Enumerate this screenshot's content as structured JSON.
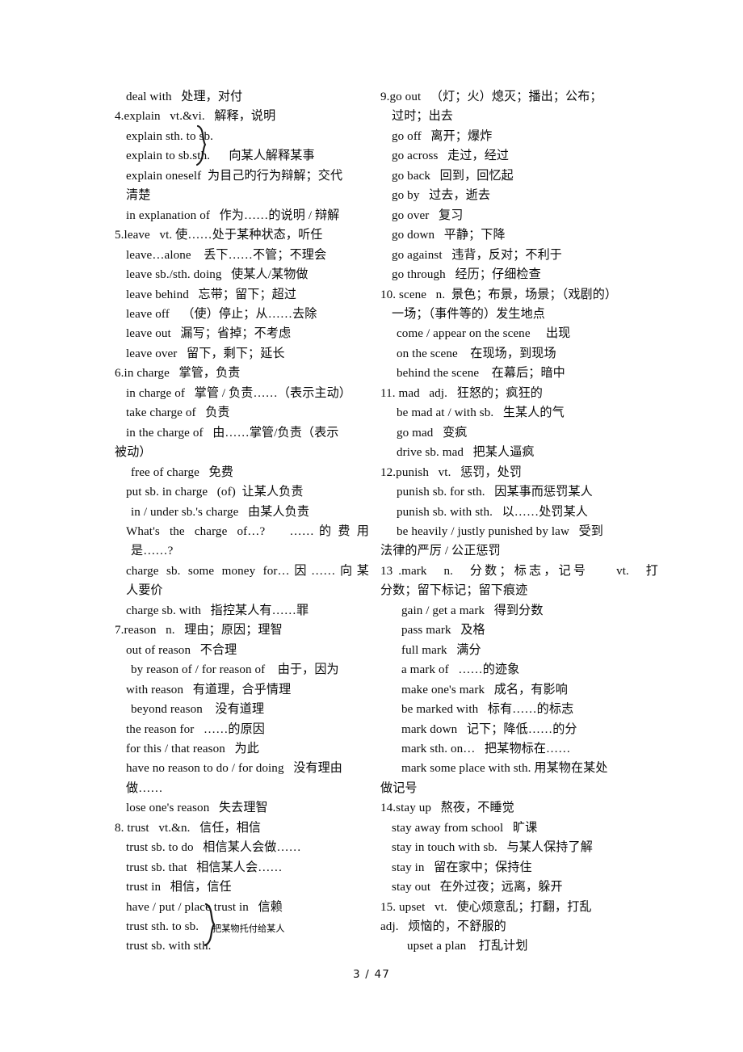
{
  "document": {
    "page_label": "3 / 47",
    "page_number": "3",
    "total_pages": "47"
  },
  "left_column": {
    "lines": [
      {
        "text": "deal with   处理，对付",
        "indent": "i1"
      },
      {
        "text": "4.explain   vt.&vi.   解释，说明",
        "indent": "i0"
      },
      {
        "text": "explain sth. to sb.",
        "indent": "i1"
      },
      {
        "text": "explain to sb.sth.      向某人解释某事",
        "indent": "i1"
      },
      {
        "text": "explain oneself  为目己旳行为辩解；交代",
        "indent": "i1"
      },
      {
        "text": "清楚",
        "indent": "i1"
      },
      {
        "text": "in explanation of   作为……的说明 / 辩解",
        "indent": "i1"
      },
      {
        "text": "5.leave   vt. 使……处于某种状态，听任",
        "indent": "i0"
      },
      {
        "text": "leave…alone    丢下……不管；不理会",
        "indent": "i1"
      },
      {
        "text": "leave sb./sth. doing   使某人/某物做",
        "indent": "i1"
      },
      {
        "text": "leave behind   忘带；留下；超过",
        "indent": "i1"
      },
      {
        "text": "leave off    （使）停止；从……去除",
        "indent": "i1"
      },
      {
        "text": "leave out   漏写；省掉；不考虑",
        "indent": "i1"
      },
      {
        "text": "leave over   留下，剩下；延长",
        "indent": "i1"
      },
      {
        "text": "6.in charge   掌管，负责",
        "indent": "i0"
      },
      {
        "text": "in charge of   掌管 / 负责……（表示主动）",
        "indent": "i1"
      },
      {
        "text": "take charge of   负责",
        "indent": "i1"
      },
      {
        "text": "in the charge of   由……掌管/负责（表示",
        "indent": "i1"
      },
      {
        "text": "被动）",
        "indent": "hang"
      },
      {
        "text": "free of charge   免费",
        "indent": "i2"
      },
      {
        "text": "put sb. in charge   (of)  让某人负责",
        "indent": "i1"
      },
      {
        "text": "in / under sb.'s charge   由某人负责",
        "indent": "i2"
      },
      {
        "text": "What's  the  charge  of…?     …… 的 费 用",
        "indent": "i1",
        "justify": "just"
      },
      {
        "text": "是……?",
        "indent": "i2"
      },
      {
        "text": "charge sb. some money for…因……向某",
        "indent": "i1",
        "justify": "just"
      },
      {
        "text": "人要价",
        "indent": "i1"
      },
      {
        "text": "charge sb. with   指控某人有……罪",
        "indent": "i1"
      },
      {
        "text": "7.reason   n.   理由；原因；理智",
        "indent": "i0"
      },
      {
        "text": "out of reason   不合理",
        "indent": "i1"
      },
      {
        "text": "by reason of / for reason of    由于，因为",
        "indent": "i2"
      },
      {
        "text": "with reason   有道理，合乎情理",
        "indent": "i1"
      },
      {
        "text": "beyond reason    没有道理",
        "indent": "i2"
      },
      {
        "text": "the reason for   ……的原因",
        "indent": "i1"
      },
      {
        "text": "for this / that reason   为此",
        "indent": "i1"
      },
      {
        "text": "have no reason to do / for doing   没有理由",
        "indent": "i1"
      },
      {
        "text": "做……",
        "indent": "i1"
      },
      {
        "text": "lose one's reason   失去理智",
        "indent": "i1"
      },
      {
        "text": "8. trust   vt.&n.   信任，相信",
        "indent": "i0"
      },
      {
        "text": "trust sb. to do   相信某人会做……",
        "indent": "i1"
      },
      {
        "text": "trust sb. that   相信某人会……",
        "indent": "i1"
      },
      {
        "text": "trust in   相信，信任",
        "indent": "i1"
      },
      {
        "text": "have / put / place trust in   信赖",
        "indent": "i1"
      },
      {
        "text": "trust sth. to sb.",
        "indent": "i1"
      },
      {
        "text": "trust sb. with sth.",
        "indent": "i1"
      }
    ],
    "annotation_note": "把某物托付给某人"
  },
  "right_column": {
    "lines": [
      {
        "text": "9.go out   （灯；火）熄灭；播出；公布；",
        "indent": "i0"
      },
      {
        "text": "过时；出去",
        "indent": "i1"
      },
      {
        "text": "go off   离开；爆炸",
        "indent": "i1"
      },
      {
        "text": "go across   走过，经过",
        "indent": "i1"
      },
      {
        "text": "go back   回到，回忆起",
        "indent": "i1"
      },
      {
        "text": "go by   过去，逝去",
        "indent": "i1"
      },
      {
        "text": "go over   复习",
        "indent": "i1"
      },
      {
        "text": "go down   平静；下降",
        "indent": "i1"
      },
      {
        "text": "go against   违背，反对；不利于",
        "indent": "i1"
      },
      {
        "text": "go through   经历；仔细检查",
        "indent": "i1"
      },
      {
        "text": "10. scene   n.  景色；布景，场景；（戏剧的）",
        "indent": "i0"
      },
      {
        "text": "一场；（事件等的）发生地点",
        "indent": "i1"
      },
      {
        "text": "come / appear on the scene     出现",
        "indent": "i2"
      },
      {
        "text": "on the scene    在现场，到现场",
        "indent": "i2"
      },
      {
        "text": "behind the scene    在幕后；暗中",
        "indent": "i2"
      },
      {
        "text": "11. mad   adj.   狂怒的；疯狂的",
        "indent": "i0"
      },
      {
        "text": "be mad at / with sb.   生某人的气",
        "indent": "i2"
      },
      {
        "text": "go mad   变疯",
        "indent": "i2"
      },
      {
        "text": "drive sb. mad   把某人逼疯",
        "indent": "i2"
      },
      {
        "text": "12.punish   vt.   惩罚，处罚",
        "indent": "i0"
      },
      {
        "text": "punish sb. for sth.   因某事而惩罚某人",
        "indent": "i2"
      },
      {
        "text": "punish sb. with sth.   以……处罚某人",
        "indent": "i2"
      },
      {
        "text": "be heavily / justly punished by law   受到",
        "indent": "i2"
      },
      {
        "text": "法律的严厉 / 公正惩罚",
        "indent": "hang"
      },
      {
        "text": "13 .mark   n.   分数；标志，记号     vt.   打",
        "indent": "i0",
        "justify": "just"
      },
      {
        "text": "分数；留下标记；留下痕迹",
        "indent": "hang"
      },
      {
        "text": "gain / get a mark   得到分数",
        "indent": "i3"
      },
      {
        "text": "pass mark   及格",
        "indent": "i3"
      },
      {
        "text": "full mark   满分",
        "indent": "i3"
      },
      {
        "text": "a mark of   ……的迹象",
        "indent": "i3"
      },
      {
        "text": "make one's mark   成名，有影响",
        "indent": "i3"
      },
      {
        "text": "be marked with   标有……的标志",
        "indent": "i3"
      },
      {
        "text": "mark down   记下；降低……的分",
        "indent": "i3"
      },
      {
        "text": "mark sth. on…   把某物标在……",
        "indent": "i3"
      },
      {
        "text": "mark some place with sth. 用某物在某处",
        "indent": "i3"
      },
      {
        "text": "做记号",
        "indent": "hang"
      },
      {
        "text": "14.stay up   熬夜，不睡觉",
        "indent": "i0"
      },
      {
        "text": "stay away from school   旷课",
        "indent": "i1"
      },
      {
        "text": "stay in touch with sb.   与某人保持了解",
        "indent": "i1"
      },
      {
        "text": "stay in   留在家中；保持住",
        "indent": "i1"
      },
      {
        "text": "stay out   在外过夜；远离，躲开",
        "indent": "i1"
      },
      {
        "text": "15. upset   vt.   使心烦意乱；打翻，打乱",
        "indent": "i0"
      },
      {
        "text": "adj.   烦恼的，不舒服的",
        "indent": "hang"
      },
      {
        "text": "upset a plan    打乱计划",
        "indent": "i4"
      }
    ]
  },
  "annotations": {
    "explain_brace": "handwritten-brace",
    "trust_brace": "handwritten-brace"
  }
}
